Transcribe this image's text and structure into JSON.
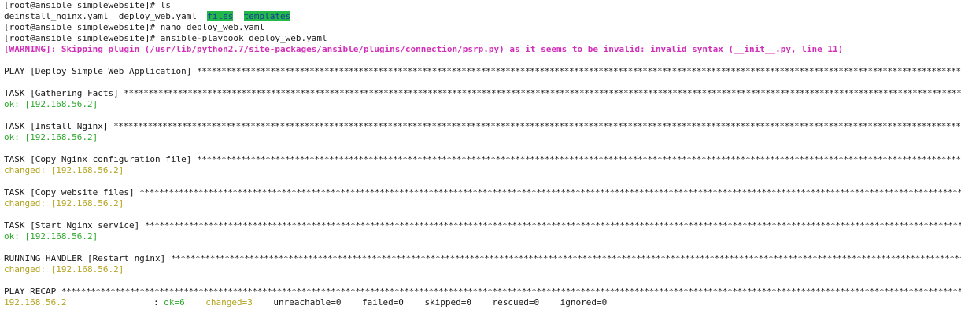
{
  "prompt": {
    "user": "root",
    "host": "ansible",
    "cwd": "simplewebsite"
  },
  "commands": [
    {
      "cmd": "ls"
    },
    {
      "cmd": "nano deploy_web.yaml"
    },
    {
      "cmd": "ansible-playbook deploy_web.yaml"
    }
  ],
  "ls_output": {
    "files": [
      "deinstall_nginx.yaml",
      "deploy_web.yaml"
    ],
    "dirs": [
      "files",
      "templates"
    ]
  },
  "warning": "[WARNING]: Skipping plugin (/usr/lib/python2.7/site-packages/ansible/plugins/connection/psrp.py) as it seems to be invalid: invalid syntax (__init__.py, line 11)",
  "play_header": "PLAY [Deploy Simple Web Application]",
  "tasks": [
    {
      "header": "TASK [Gathering Facts]",
      "status": "ok",
      "result": "ok: [192.168.56.2]"
    },
    {
      "header": "TASK [Install Nginx]",
      "status": "ok",
      "result": "ok: [192.168.56.2]"
    },
    {
      "header": "TASK [Copy Nginx configuration file]",
      "status": "changed",
      "result": "changed: [192.168.56.2]"
    },
    {
      "header": "TASK [Copy website files]",
      "status": "changed",
      "result": "changed: [192.168.56.2]"
    },
    {
      "header": "TASK [Start Nginx service]",
      "status": "ok",
      "result": "ok: [192.168.56.2]"
    },
    {
      "header": "RUNNING HANDLER [Restart nginx]",
      "status": "changed",
      "result": "changed: [192.168.56.2]"
    }
  ],
  "recap": {
    "header": "PLAY RECAP",
    "host": "192.168.56.2",
    "sep": ":",
    "ok": "ok=6",
    "changed": "changed=3",
    "unreachable": "unreachable=0",
    "failed": "failed=0",
    "skipped": "skipped=0",
    "rescued": "rescued=0",
    "ignored": "ignored=0"
  },
  "colors": {
    "warning": "#d12fb8",
    "ok": "#2fa82f",
    "changed": "#b3a420",
    "dir_highlight": "#22b84a",
    "dir_text": "#1a3a9a"
  }
}
